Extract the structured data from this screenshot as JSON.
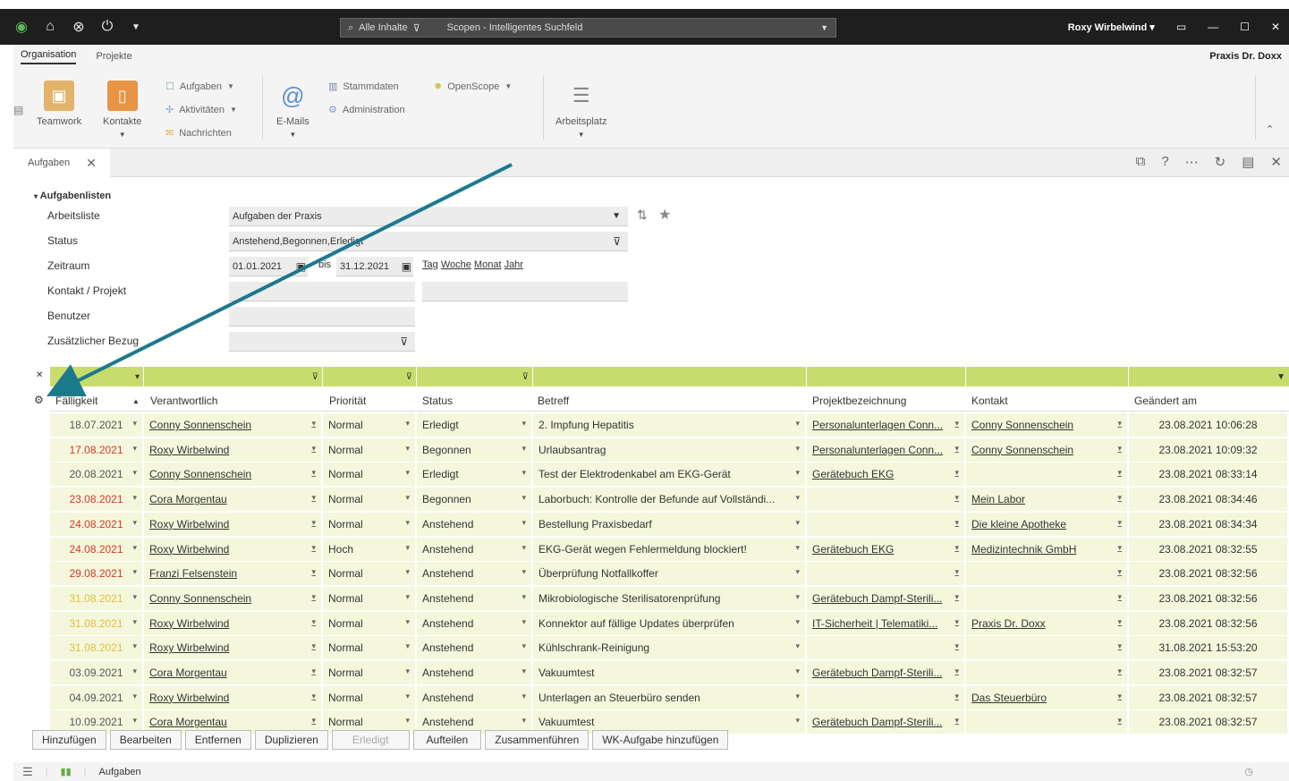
{
  "titlebar": {
    "search_placeholder": "Alle Inhalte",
    "scope_label": "Scopen - Intelligentes Suchfeld",
    "user": "Roxy Wirbelwind",
    "colors": {
      "bg": "#1e1e1e"
    }
  },
  "ribbon_tabs": {
    "tab1": "Organisation",
    "tab2": "Projekte",
    "org": "Praxis Dr. Doxx"
  },
  "ribbon": {
    "teamwork": "Teamwork",
    "kontakte": "Kontakte",
    "aufgaben": "Aufgaben",
    "aktivitaeten": "Aktivitäten",
    "nachrichten": "Nachrichten",
    "emails": "E-Mails",
    "stammdaten": "Stammdaten",
    "administration": "Administration",
    "openscope": "OpenScope",
    "arbeitsplatz": "Arbeitsplatz"
  },
  "doctab": {
    "label": "Aufgaben"
  },
  "form": {
    "section_title": "Aufgabenlisten",
    "arbeitsliste_label": "Arbeitsliste",
    "arbeitsliste_value": "Aufgaben der Praxis",
    "status_label": "Status",
    "status_value": "Anstehend,Begonnen,Erledigt",
    "zeitraum_label": "Zeitraum",
    "date_from": "01.01.2021",
    "bis": "bis",
    "date_to": "31.12.2021",
    "links": [
      "Tag",
      "Woche",
      "Monat",
      "Jahr"
    ],
    "kontakt_label": "Kontakt / Projekt",
    "benutzer_label": "Benutzer",
    "bezug_label": "Zusätzlicher Bezug"
  },
  "grid": {
    "headers": [
      "Fälligkeit",
      "Verantwortlich",
      "Priorität",
      "Status",
      "Betreff",
      "Projektbezeichnung",
      "Kontakt",
      "Geändert am"
    ],
    "rows": [
      {
        "date": "18.07.2021",
        "date_color": "#555555",
        "resp": "Conny Sonnenschein",
        "prio": "Normal",
        "status": "Erledigt",
        "subject": "2. Impfung Hepatitis",
        "project": "Personalunterlagen Conn...",
        "contact": "Conny Sonnenschein",
        "changed": "23.08.2021 10:06:28"
      },
      {
        "date": "17.08.2021",
        "date_color": "#d33a2c",
        "resp": "Roxy Wirbelwind",
        "prio": "Normal",
        "status": "Begonnen",
        "subject": "Urlaubsantrag",
        "project": "Personalunterlagen Conn...",
        "contact": "Conny Sonnenschein",
        "changed": "23.08.2021 10:09:32"
      },
      {
        "date": "20.08.2021",
        "date_color": "#555555",
        "resp": "Conny Sonnenschein",
        "prio": "Normal",
        "status": "Erledigt",
        "subject": "Test der Elektrodenkabel am EKG-Gerät",
        "project": "Gerätebuch EKG",
        "contact": "",
        "changed": "23.08.2021 08:33:14"
      },
      {
        "date": "23.08.2021",
        "date_color": "#d33a2c",
        "resp": "Cora Morgentau",
        "prio": "Normal",
        "status": "Begonnen",
        "subject": "Laborbuch: Kontrolle der Befunde auf Vollständi...",
        "project": "",
        "contact": "Mein Labor",
        "changed": "23.08.2021 08:34:46"
      },
      {
        "date": "24.08.2021",
        "date_color": "#d33a2c",
        "resp": "Roxy Wirbelwind",
        "prio": "Normal",
        "status": "Anstehend",
        "subject": "Bestellung Praxisbedarf",
        "project": "",
        "contact": "Die kleine Apotheke",
        "changed": "23.08.2021 08:34:34"
      },
      {
        "date": "24.08.2021",
        "date_color": "#d33a2c",
        "resp": "Roxy Wirbelwind",
        "prio": "Hoch",
        "status": "Anstehend",
        "subject": "EKG-Gerät wegen Fehlermeldung blockiert!",
        "project": "Gerätebuch EKG",
        "contact": "Medizintechnik GmbH",
        "changed": "23.08.2021 08:32:55"
      },
      {
        "date": "29.08.2021",
        "date_color": "#d33a2c",
        "resp": "Franzi Felsenstein",
        "prio": "Normal",
        "status": "Anstehend",
        "subject": "Überprüfung Notfallkoffer",
        "project": "",
        "contact": "",
        "changed": "23.08.2021 08:32:56"
      },
      {
        "date": "31.08.2021",
        "date_color": "#e0c040",
        "resp": "Conny Sonnenschein",
        "prio": "Normal",
        "status": "Anstehend",
        "subject": "Mikrobiologische Sterilisatorenprüfung",
        "project": "Gerätebuch Dampf-Sterili...",
        "contact": "",
        "changed": "23.08.2021 08:32:56"
      },
      {
        "date": "31.08.2021",
        "date_color": "#e0c040",
        "resp": "Roxy Wirbelwind",
        "prio": "Normal",
        "status": "Anstehend",
        "subject": "Konnektor auf fällige Updates überprüfen",
        "project": "IT-Sicherheit | Telematiki...",
        "contact": "Praxis Dr. Doxx",
        "changed": "23.08.2021 08:32:56"
      },
      {
        "date": "31.08.2021",
        "date_color": "#e0c040",
        "resp": "Roxy Wirbelwind",
        "prio": "Normal",
        "status": "Anstehend",
        "subject": "Kühlschrank-Reinigung",
        "project": "",
        "contact": "",
        "changed": "31.08.2021 15:53:20"
      },
      {
        "date": "03.09.2021",
        "date_color": "#555555",
        "resp": "Cora Morgentau",
        "prio": "Normal",
        "status": "Anstehend",
        "subject": "Vakuumtest",
        "project": "Gerätebuch Dampf-Sterili...",
        "contact": "",
        "changed": "23.08.2021 08:32:57"
      },
      {
        "date": "04.09.2021",
        "date_color": "#555555",
        "resp": "Roxy Wirbelwind",
        "prio": "Normal",
        "status": "Anstehend",
        "subject": "Unterlagen an Steuerbüro senden",
        "project": "",
        "contact": "Das Steuerbüro",
        "changed": "23.08.2021 08:32:57"
      },
      {
        "date": "10.09.2021",
        "date_color": "#555555",
        "resp": "Cora Morgentau",
        "prio": "Normal",
        "status": "Anstehend",
        "subject": "Vakuumtest",
        "project": "Gerätebuch Dampf-Sterili...",
        "contact": "",
        "changed": "23.08.2021 08:32:57"
      }
    ]
  },
  "buttons": [
    "Hinzufügen",
    "Bearbeiten",
    "Entfernen",
    "Duplizieren",
    "Erledigt",
    "Aufteilen",
    "Zusammenführen",
    "WK-Aufgabe hinzufügen"
  ],
  "statusbar": {
    "label": "Aufgaben"
  },
  "accent": {
    "filter_row": "#c8dc6e",
    "row_bg": "#f4f7dc",
    "arrow": "#1b7a8a"
  }
}
